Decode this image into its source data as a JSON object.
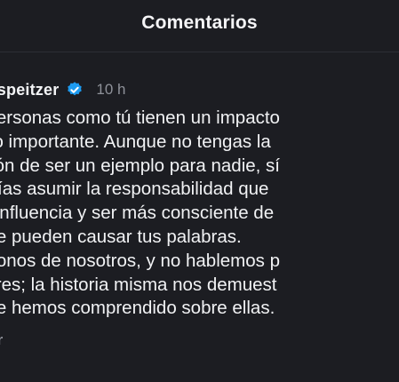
{
  "header": {
    "title": "Comentarios"
  },
  "comment": {
    "username": "ndrospeitzer",
    "time": "10 h",
    "lines": [
      "er, personas como tú tienen un impacto",
      "iático importante. Aunque no tengas la",
      "gación de ser un ejemplo para nadie, sí",
      "podrías asumir la responsabilidad que",
      "esa influencia y ser más consciente de",
      "o que pueden causar tus palabras.",
      "pémonos de nosotros, y no hablemos p",
      "nujeres; la historia misma nos demuest",
      "o que hemos comprendido sobre ellas."
    ],
    "reply_label": "onder"
  },
  "colors": {
    "background": "#1c1d22",
    "verified": "#1d9bf0",
    "muted": "#8e9199"
  }
}
